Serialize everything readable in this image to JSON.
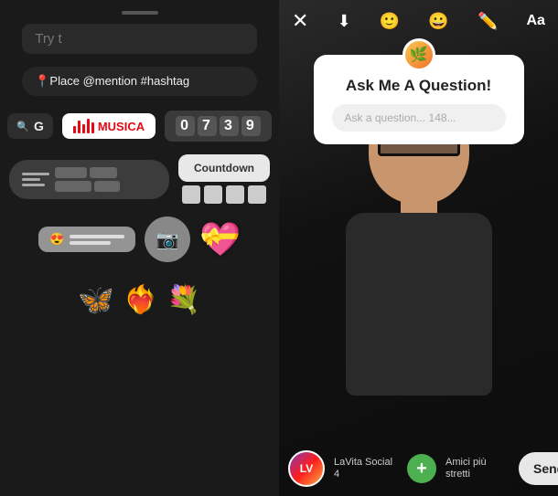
{
  "left_panel": {
    "search_placeholder": "Try t",
    "tags_text": "📍Place @mention #hashtag",
    "gif_label": "G",
    "gif_search_icon": "🔍",
    "music_label": "MUSICA",
    "digits": [
      "0",
      "7",
      "3",
      "9"
    ],
    "countdown_label": "Countdown",
    "poll_label": "",
    "camera_icon": "📷",
    "heart_emoji": "💝"
  },
  "right_panel": {
    "close_icon": "✕",
    "download_icon": "⬇",
    "face_icon": "🙂",
    "sticker_icon": "😊",
    "pencil_icon": "✏",
    "aa_label": "Aa",
    "question_title": "Ask Me A Question!",
    "question_placeholder": "Ask a question... 148...",
    "bottom_username": "LaVita Social 4",
    "bottom_circle_label": "Amici più stretti",
    "send_to_label": "Send To ›"
  }
}
